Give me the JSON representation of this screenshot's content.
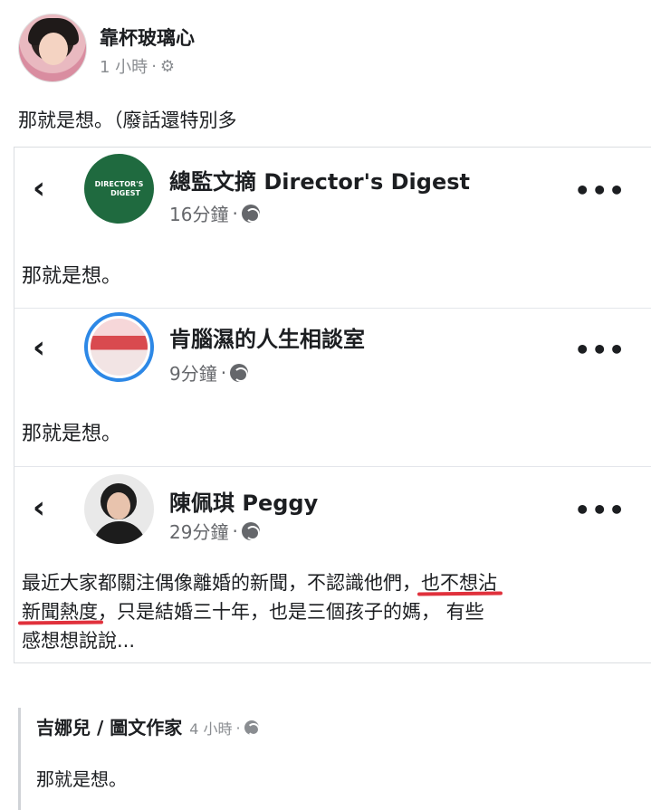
{
  "top_post": {
    "author": "靠杯玻璃心",
    "time": "1 小時",
    "separator": "·",
    "privacy_icon": "gear-icon",
    "text": "那就是想。（廢話還特別多"
  },
  "shared_posts": [
    {
      "page_name": "總監文摘 Director's Digest",
      "avatar_line1": "DIRECTOR'S",
      "avatar_line2": "DIGEST",
      "time": "16分鐘",
      "separator": "·",
      "privacy_icon": "globe-icon",
      "text": "那就是想。"
    },
    {
      "page_name": "肯腦濕的人生相談室",
      "time": "9分鐘",
      "separator": "·",
      "privacy_icon": "globe-icon",
      "text": "那就是想。"
    },
    {
      "page_name": "陳佩琪 Peggy",
      "time": "29分鐘",
      "separator": "·",
      "privacy_icon": "globe-icon",
      "text_line1_a": "最近大家都關注偶像離婚的新聞，不認識他們，",
      "text_line1_b": "也不想沾",
      "text_line2_a": "新聞熱度",
      "text_line2_b": "，只是結婚三十年，也是三個孩子的媽， 有些",
      "text_line3": "感想想說說..."
    }
  ],
  "controls": {
    "back_glyph": "‹",
    "more_glyph": "•••"
  },
  "comment": {
    "author": "吉娜兒 / 圖文作家",
    "time": "4 小時",
    "separator": "·",
    "privacy_icon": "globe-icon",
    "text": "那就是想。"
  },
  "colors": {
    "underline": "#e0313c",
    "digest_green": "#1f6a3f",
    "ring_blue": "#2d88e6"
  }
}
